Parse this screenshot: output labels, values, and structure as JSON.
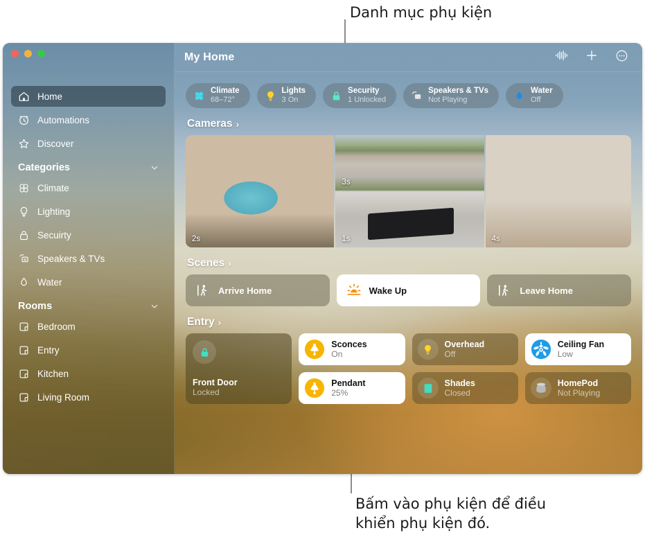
{
  "annotations": {
    "top": "Danh mục phụ kiện",
    "bottom_line1": "Bấm vào phụ kiện để điều",
    "bottom_line2": "khiển phụ kiện đó."
  },
  "window": {
    "traffic_lights": [
      "close-button",
      "minimize-button",
      "maximize-button"
    ]
  },
  "toolbar": {
    "title": "My Home",
    "actions": [
      {
        "name": "audio-waveform-icon"
      },
      {
        "name": "add-icon"
      },
      {
        "name": "more-options-icon"
      }
    ]
  },
  "sidebar": {
    "primary": [
      {
        "label": "Home",
        "icon": "house-icon",
        "active": true
      },
      {
        "label": "Automations",
        "icon": "clock-icon",
        "active": false
      },
      {
        "label": "Discover",
        "icon": "star-icon",
        "active": false
      }
    ],
    "categories_header": "Categories",
    "categories": [
      {
        "label": "Climate",
        "icon": "fan-icon"
      },
      {
        "label": "Lighting",
        "icon": "bulb-icon"
      },
      {
        "label": "Secuirty",
        "icon": "lock-icon"
      },
      {
        "label": "Speakers & TVs",
        "icon": "speaker-tv-icon"
      },
      {
        "label": "Water",
        "icon": "droplet-icon"
      }
    ],
    "rooms_header": "Rooms",
    "rooms": [
      {
        "label": "Bedroom",
        "icon": "room-icon"
      },
      {
        "label": "Entry",
        "icon": "room-icon"
      },
      {
        "label": "Kitchen",
        "icon": "room-icon"
      },
      {
        "label": "Living Room",
        "icon": "room-icon"
      }
    ]
  },
  "chips": [
    {
      "name": "Climate",
      "status": "68–72°",
      "icon": "fan-icon",
      "color": "#45d9e8"
    },
    {
      "name": "Lights",
      "status": "3 On",
      "icon": "bulb-icon",
      "color": "#ffd426"
    },
    {
      "name": "Security",
      "status": "1 Unlocked",
      "icon": "lock-icon",
      "color": "#5ce8c8"
    },
    {
      "name": "Speakers & TVs",
      "status": "Not Playing",
      "icon": "speaker-tv-icon",
      "color": "#e6e6e6"
    },
    {
      "name": "Water",
      "status": "Off",
      "icon": "droplet-icon",
      "color": "#1f8ce8"
    }
  ],
  "sections": {
    "cameras": "Cameras",
    "scenes": "Scenes",
    "entry": "Entry",
    "arrow": "›"
  },
  "cameras": [
    {
      "name": "pool-camera",
      "label": "2s"
    },
    {
      "name": "driveway-camera",
      "label": "3s"
    },
    {
      "name": "garage-camera",
      "label": "1s"
    },
    {
      "name": "living-room-camera",
      "label": "4s"
    }
  ],
  "scenes": [
    {
      "label": "Arrive Home",
      "icon": "walking-person-icon",
      "active": false
    },
    {
      "label": "Wake Up",
      "icon": "sunrise-icon",
      "active": true
    },
    {
      "label": "Leave Home",
      "icon": "walking-person-icon",
      "active": false
    }
  ],
  "accessories": [
    {
      "name": "Front Door",
      "status": "Locked",
      "icon": "lock-icon",
      "active": false,
      "size": "large",
      "accent": "#3fe0c4"
    },
    {
      "name": "Sconces",
      "status": "On",
      "icon": "lamp-icon",
      "active": true,
      "size": "small",
      "accent": "#f7b500"
    },
    {
      "name": "Pendant",
      "status": "25%",
      "icon": "lamp-icon",
      "active": true,
      "size": "small",
      "accent": "#f7b500"
    },
    {
      "name": "Overhead",
      "status": "Off",
      "icon": "bulb-icon",
      "active": false,
      "size": "small",
      "accent": "#ffd426"
    },
    {
      "name": "Shades",
      "status": "Closed",
      "icon": "shade-icon",
      "active": false,
      "size": "small",
      "accent": "#3fe0c4"
    },
    {
      "name": "Ceiling Fan",
      "status": "Low",
      "icon": "ceiling-fan-icon",
      "active": true,
      "size": "small",
      "accent": "#1f9ce8"
    },
    {
      "name": "HomePod",
      "status": "Not Playing",
      "icon": "homepod-icon",
      "active": false,
      "size": "small",
      "accent": "#b9b9b9"
    }
  ]
}
